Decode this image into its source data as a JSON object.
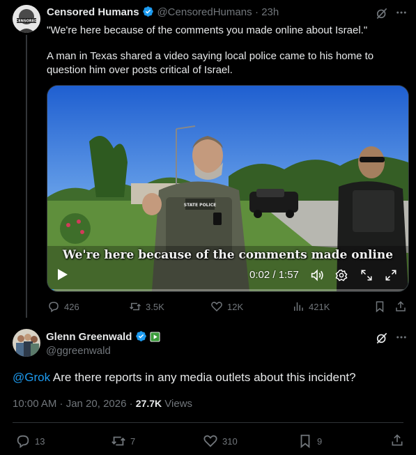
{
  "tweet1": {
    "author_name": "Censored Humans",
    "author_handle": "@CensoredHumans",
    "time": "· 23h",
    "avatar_label": "CENSORED",
    "text_line1": "\"We're here because of the comments you made online about Israel.\"",
    "text_line2": "A man in Texas shared a video saying local police came to his home to question him over posts critical of Israel.",
    "video": {
      "subtitle": "We're here because of the comments made online",
      "time": "0:02 / 1:57",
      "progress": 0.017,
      "badge_text": "STATE POLICE"
    },
    "actions": {
      "replies": "426",
      "reposts": "3.5K",
      "likes": "12K",
      "views": "421K"
    }
  },
  "tweet2": {
    "author_name": "Glenn Greenwald",
    "author_handle": "@ggreenwald",
    "mention": "@Grok",
    "text": " Are there reports in any media outlets about this incident?",
    "timestamp": "10:00 AM · Jan 20, 2026 · ",
    "views_count": "27.7K",
    "views_label": " Views",
    "actions": {
      "replies": "13",
      "reposts": "7",
      "likes": "310",
      "bookmarks": "9"
    }
  },
  "colors": {
    "background": "#000000",
    "text": "#e7e9ea",
    "muted": "#71767b",
    "accent": "#1d9bf0",
    "verified": "#1d9bf0",
    "divider": "#2f3336"
  }
}
